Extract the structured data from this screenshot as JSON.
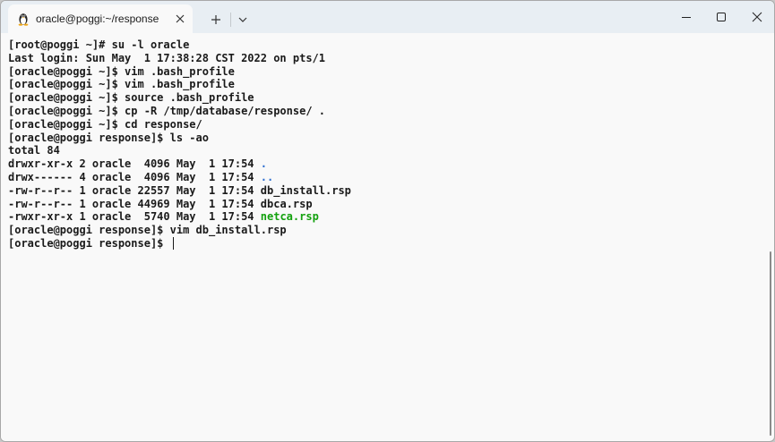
{
  "tab": {
    "title": "oracle@poggi:~/response",
    "icon": "linux-tux-icon"
  },
  "toolbar": {
    "new_tab_icon": "plus-icon",
    "dropdown_icon": "chevron-down-icon"
  },
  "window_controls": {
    "minimize_icon": "minimize-icon",
    "maximize_icon": "maximize-icon",
    "close_icon": "close-icon"
  },
  "colors": {
    "blue": "#2f6fd0",
    "green": "#13a10e",
    "text": "#1a1a1a"
  },
  "terminal": {
    "lines": [
      {
        "text": "[root@poggi ~]# su -l oracle"
      },
      {
        "text": "Last login: Sun May  1 17:38:28 CST 2022 on pts/1"
      },
      {
        "text": "[oracle@poggi ~]$ vim .bash_profile"
      },
      {
        "text": "[oracle@poggi ~]$ vim .bash_profile"
      },
      {
        "text": "[oracle@poggi ~]$ source .bash_profile"
      },
      {
        "text": "[oracle@poggi ~]$ cp -R /tmp/database/response/ ."
      },
      {
        "text": "[oracle@poggi ~]$ cd response/"
      },
      {
        "text": "[oracle@poggi response]$ ls -ao"
      },
      {
        "text": "total 84"
      },
      {
        "text": "drwxr-xr-x 2 oracle  4096 May  1 17:54 ",
        "name": ".",
        "color": "blue"
      },
      {
        "text": "drwx------ 4 oracle  4096 May  1 17:54 ",
        "name": "..",
        "color": "blue"
      },
      {
        "text": "-rw-r--r-- 1 oracle 22557 May  1 17:54 ",
        "name": "db_install.rsp"
      },
      {
        "text": "-rw-r--r-- 1 oracle 44969 May  1 17:54 ",
        "name": "dbca.rsp"
      },
      {
        "text": "-rwxr-xr-x 1 oracle  5740 May  1 17:54 ",
        "name": "netca.rsp",
        "color": "green"
      },
      {
        "text": "[oracle@poggi response]$ vim db_install.rsp"
      },
      {
        "text": "[oracle@poggi response]$ ",
        "cursor": true
      }
    ]
  }
}
